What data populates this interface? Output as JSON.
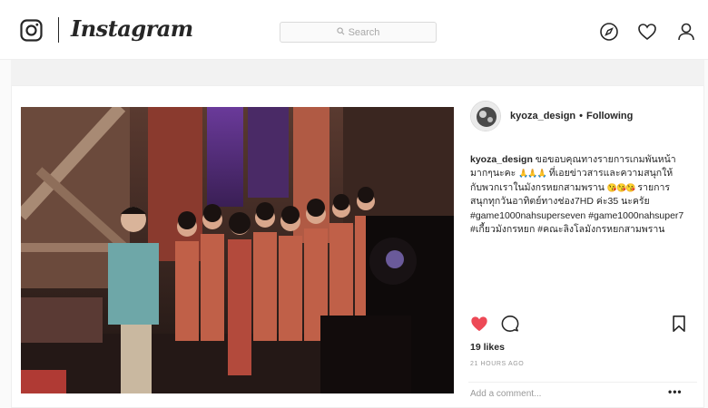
{
  "nav": {
    "brand": "Instagram",
    "search_placeholder": "Search",
    "icons": [
      "instagram-camera-icon",
      "search-icon",
      "explore-compass-icon",
      "heart-icon",
      "profile-icon"
    ]
  },
  "post": {
    "username": "kyoza_design",
    "separator": "•",
    "follow_status": "Following",
    "caption_user": "kyoza_design",
    "caption_line1": " ขอขอบคุณทางรายการเกมพันหน้ามากๆนะคะ ",
    "caption_emoji1": "🙏🙏🙏",
    "caption_line2": " ที่เอยข่าวสารและความสนุกให้กับพวกเราในมังกรหยกสามพราน ",
    "caption_emoji2": "😘😘😘",
    "caption_line3": " รายการสนุกทุกวันอาทิตย์ทางช่อง7HD ค่ะ35 นะครัย #game1000nahsuperseven #game1000nahsuper7 #เกี้ยวมังกรหยก #คณะลิงโลมังกรหยกสามพราน",
    "likes": "19 likes",
    "time": "21 HOURS AGO",
    "comment_placeholder": "Add a comment...",
    "more_label": "•••",
    "icons": [
      "like-heart-icon",
      "comment-icon",
      "bookmark-icon"
    ]
  },
  "colors": {
    "like_red": "#ed4956",
    "text": "#262626",
    "muted": "#999999",
    "border": "#efefef"
  }
}
